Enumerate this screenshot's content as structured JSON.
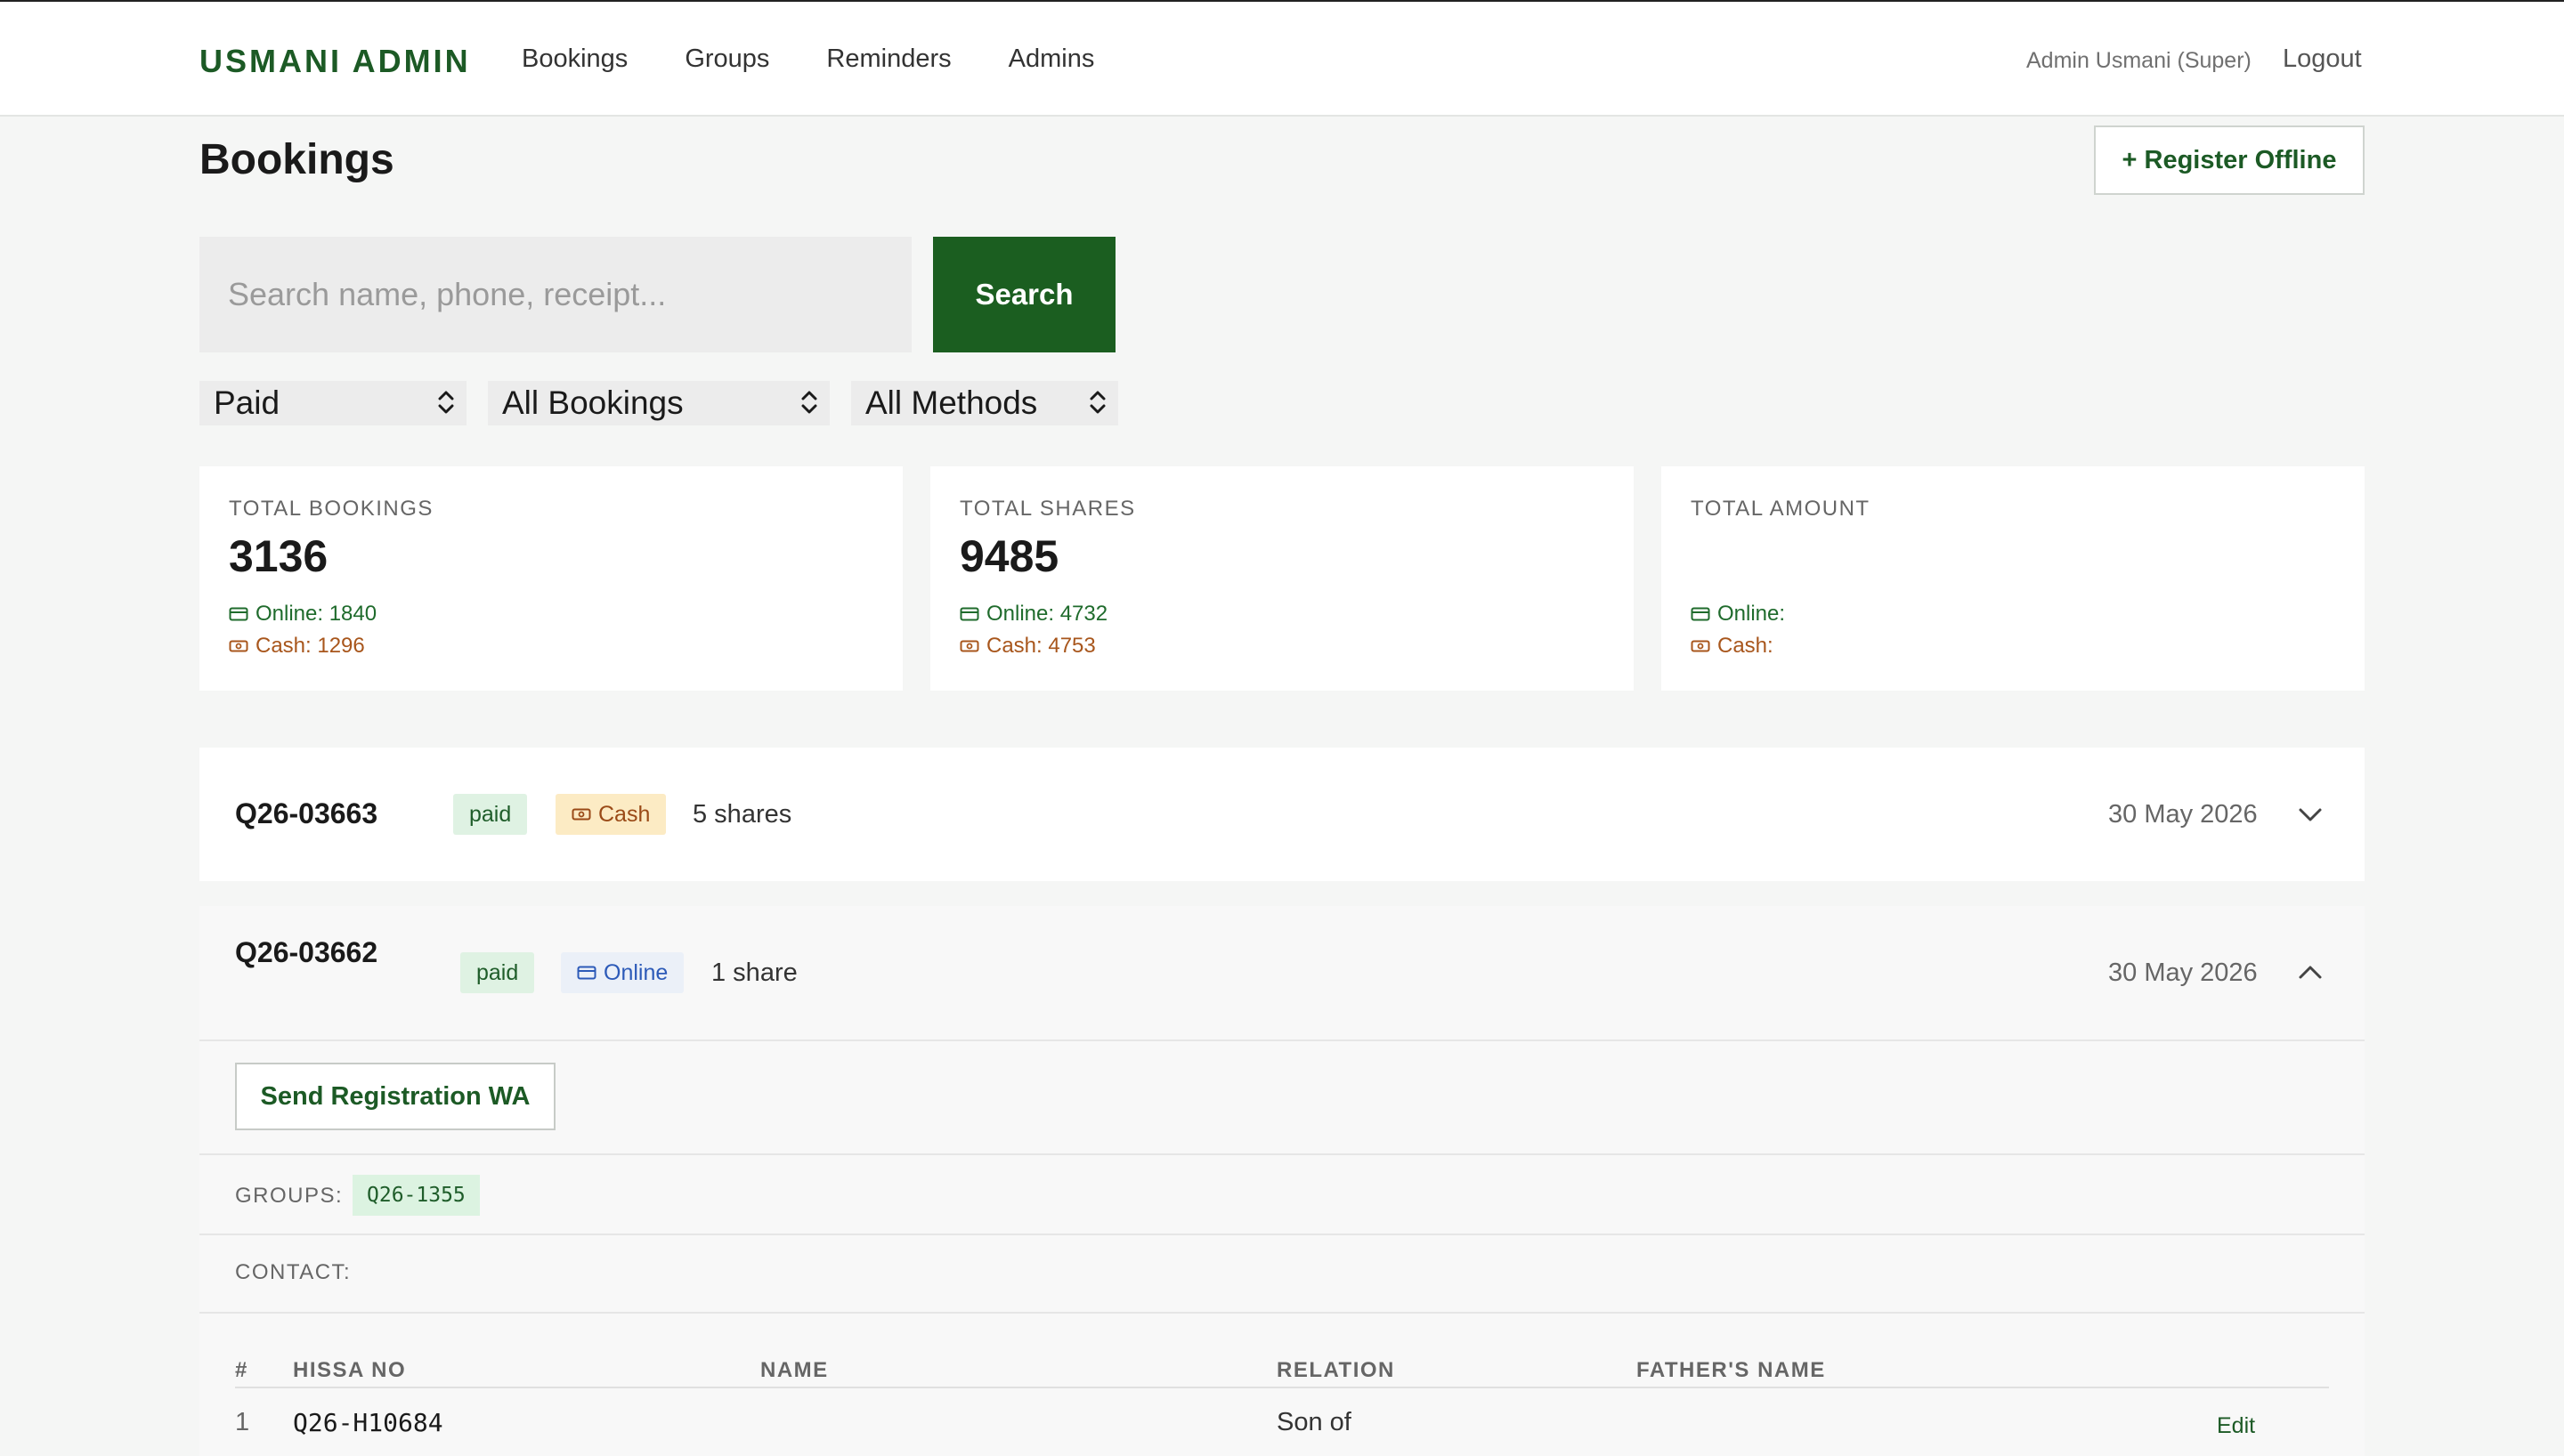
{
  "nav": {
    "brand": "USMANI ADMIN",
    "links": [
      "Bookings",
      "Groups",
      "Reminders",
      "Admins"
    ],
    "user": "Admin Usmani (Super)",
    "logout": "Logout"
  },
  "header": {
    "title": "Bookings",
    "register_label": "+ Register Offline"
  },
  "search": {
    "placeholder": "Search name, phone, receipt...",
    "value": "",
    "button": "Search"
  },
  "filters": {
    "status": "Paid",
    "type": "All Bookings",
    "method": "All Methods"
  },
  "stats": [
    {
      "label": "TOTAL BOOKINGS",
      "value": "3136",
      "online": "Online: 1840",
      "cash": "Cash: 1296"
    },
    {
      "label": "TOTAL SHARES",
      "value": "9485",
      "online": "Online: 4732",
      "cash": "Cash: 4753"
    },
    {
      "label": "TOTAL AMOUNT",
      "value": "",
      "online": "Online:",
      "cash": "Cash:"
    }
  ],
  "bookings": [
    {
      "receipt": "Q26-03663",
      "status": "paid",
      "method": "Cash",
      "shares": "5 shares",
      "date": "30 May 2026",
      "expanded": false
    },
    {
      "receipt": "Q26-03662",
      "status": "paid",
      "method": "Online",
      "shares": "1 share",
      "date": "30 May 2026",
      "expanded": true
    }
  ],
  "detail": {
    "send_label": "Send Registration WA",
    "groups_label": "GROUPS:",
    "group_chip": "Q26-1355",
    "contact_label": "CONTACT:",
    "columns": [
      "#",
      "HISSA NO",
      "NAME",
      "RELATION",
      "FATHER'S NAME"
    ],
    "rows": [
      {
        "num": "1",
        "hissa": "Q26-H10684",
        "name": "",
        "relation": "Son of",
        "father": "",
        "action": "Edit"
      }
    ]
  },
  "colors": {
    "brand_green": "#1c5a25",
    "button_green": "#1b5e20",
    "cash_orange": "#a8561c",
    "online_blue": "#2c5ab8"
  },
  "icons": {
    "select": "updown-chevron-icon",
    "online": "card-icon",
    "cash": "cash-icon",
    "collapsed": "chevron-down-icon",
    "expanded": "chevron-up-icon"
  }
}
